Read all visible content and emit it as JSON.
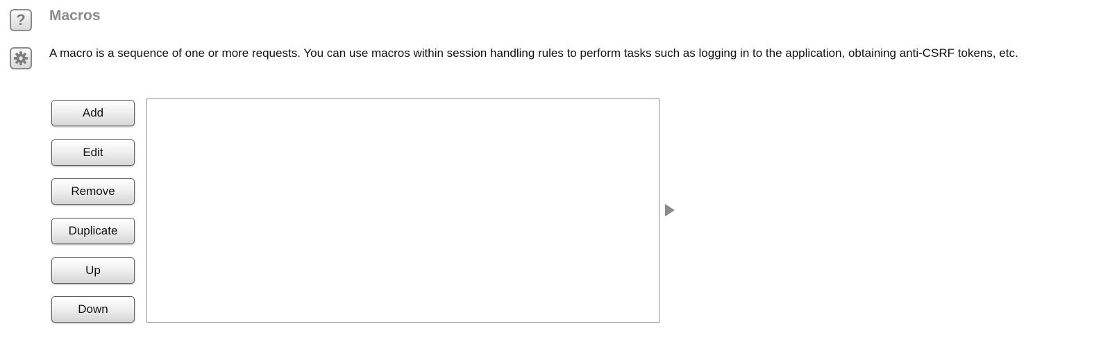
{
  "section": {
    "title": "Macros",
    "description": "A macro is a sequence of one or more requests. You can use macros within session handling rules to perform tasks such as logging in to the application, obtaining anti-CSRF tokens, etc."
  },
  "icons": {
    "help": "?",
    "help_icon_name": "help-icon",
    "settings_icon_name": "gear-icon",
    "expand_icon_name": "expand-arrow-icon"
  },
  "buttons": {
    "add": "Add",
    "edit": "Edit",
    "remove": "Remove",
    "duplicate": "Duplicate",
    "up": "Up",
    "down": "Down"
  },
  "macro_list": {
    "items": []
  },
  "colors": {
    "title": "#8c8c8c",
    "icon_border": "#8a8a8a",
    "list_border": "#8f8f8f"
  }
}
